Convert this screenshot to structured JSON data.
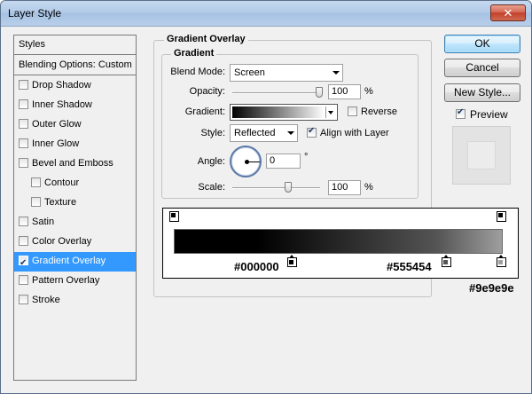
{
  "window": {
    "title": "Layer Style",
    "close_glyph": "✕"
  },
  "styles_panel": {
    "header": "Styles",
    "blending": "Blending Options: Custom",
    "items": [
      {
        "label": "Drop Shadow",
        "checked": false,
        "indent": false,
        "selected": false
      },
      {
        "label": "Inner Shadow",
        "checked": false,
        "indent": false,
        "selected": false
      },
      {
        "label": "Outer Glow",
        "checked": false,
        "indent": false,
        "selected": false
      },
      {
        "label": "Inner Glow",
        "checked": false,
        "indent": false,
        "selected": false
      },
      {
        "label": "Bevel and Emboss",
        "checked": false,
        "indent": false,
        "selected": false
      },
      {
        "label": "Contour",
        "checked": false,
        "indent": true,
        "selected": false
      },
      {
        "label": "Texture",
        "checked": false,
        "indent": true,
        "selected": false
      },
      {
        "label": "Satin",
        "checked": false,
        "indent": false,
        "selected": false
      },
      {
        "label": "Color Overlay",
        "checked": false,
        "indent": false,
        "selected": false
      },
      {
        "label": "Gradient Overlay",
        "checked": true,
        "indent": false,
        "selected": true
      },
      {
        "label": "Pattern Overlay",
        "checked": false,
        "indent": false,
        "selected": false
      },
      {
        "label": "Stroke",
        "checked": false,
        "indent": false,
        "selected": false
      }
    ]
  },
  "gradient_overlay": {
    "group_title": "Gradient Overlay",
    "subgroup_title": "Gradient",
    "blend_mode": {
      "label": "Blend Mode:",
      "value": "Screen"
    },
    "opacity": {
      "label": "Opacity:",
      "value": "100",
      "unit": "%",
      "level": 1.0
    },
    "gradient": {
      "label": "Gradient:",
      "from_color": "#000000",
      "to_color": "#ffffff"
    },
    "reverse": {
      "label": "Reverse",
      "checked": false
    },
    "style": {
      "label": "Style:",
      "value": "Reflected"
    },
    "align": {
      "label": "Align with Layer",
      "checked": true
    },
    "angle": {
      "label": "Angle:",
      "value": "0",
      "unit": "°"
    },
    "scale": {
      "label": "Scale:",
      "value": "100",
      "unit": "%",
      "level": 0.4
    }
  },
  "gradient_editor": {
    "bar_from": "#000000",
    "bar_mid": "#555454",
    "bar_to": "#9e9e9e",
    "stops": [
      {
        "label": "#000000",
        "color": "#000000"
      },
      {
        "label": "#555454",
        "color": "#555454"
      },
      {
        "label": "#9e9e9e",
        "color": "#9e9e9e"
      }
    ]
  },
  "buttons": {
    "ok": "OK",
    "cancel": "Cancel",
    "new_style": "New Style..."
  },
  "preview": {
    "label": "Preview",
    "checked": true
  },
  "colors": {
    "selection": "#3399ff",
    "title_bar": "#b3cbe8",
    "close": "#c2402a"
  }
}
